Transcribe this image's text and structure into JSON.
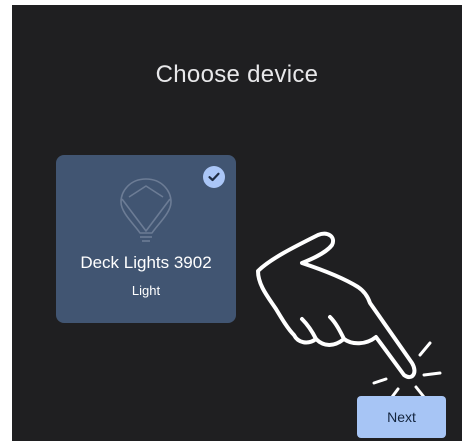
{
  "screen": {
    "title": "Choose device"
  },
  "device_card": {
    "name": "Deck Lights 3902",
    "type": "Light",
    "selected": true,
    "icon": "lightbulb-icon",
    "check_icon": "checkmark-circle-icon"
  },
  "overlay": {
    "icon": "pointing-hand-icon"
  },
  "footer": {
    "next_label": "Next"
  },
  "colors": {
    "background": "#1f1f21",
    "card": "#415572",
    "accent": "#a7c5f5",
    "text": "#ffffff"
  }
}
